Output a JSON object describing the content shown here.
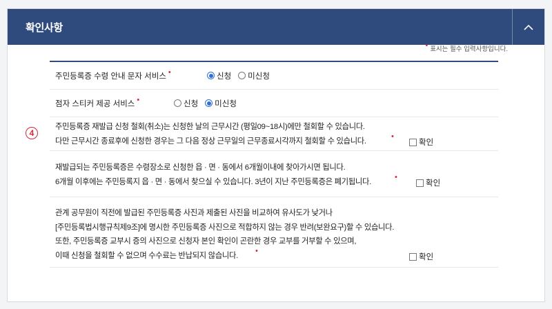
{
  "panel": {
    "title": "확인사항",
    "toggle_icon": "chevron-up-icon"
  },
  "required_note": {
    "marker": "•",
    "text": "표시는 필수 입력사항입니다."
  },
  "step_number": "4",
  "options": [
    {
      "label": "주민등록증 수령 안내 문자 서비스",
      "required_marker": "•",
      "choices": [
        "신청",
        "미신청"
      ],
      "selected": "신청"
    },
    {
      "label": "점자 스티커 제공 서비스",
      "required_marker": "•",
      "choices": [
        "신청",
        "미신청"
      ],
      "selected": "미신청"
    }
  ],
  "notices": [
    {
      "lines": [
        "주민등록증 재발급 신청 철회(취소)는 신청한 날의 근무시간 (평일09~18시)에만 철회할 수 있습니다.",
        "다만 근무시간 종료후에 신청한 경우는 그 다음 정상 근무일의 근무종료시각까지 철회할 수 있습니다."
      ],
      "required_marker": "•",
      "confirm_label": "확인",
      "checked": false
    },
    {
      "lines": [
        "재발급되는 주민등록증은 수령장소로 신청한 읍 · 면 · 동에서 6개월이내에 찾아가시면 됩니다.",
        "6개월 이후에는 주민등록지 읍 · 면 · 동에서 찾으실 수 있습니다. 3년이 지난 주민등록증은 폐기됩니다."
      ],
      "required_marker": "•",
      "confirm_label": "확인",
      "checked": false
    },
    {
      "lines": [
        "관계 공무원이 직전에 발급된 주민등록증 사진과 제출된 사진을 비교하여 유사도가 낮거나",
        "[주민등록법시행규칙제9조]에 명시한 주민등록증 사진으로 적합하지 않는 경우 반려(보완요구)할 수 있습니다.",
        "또한, 주민등록증 교부시 증의 사진으로 신청자 본인 확인이 곤란한 경우 교부를 거부할 수 있으며,",
        "이때 신청을 철회할 수 없으며 수수료는 반납되지 않습니다."
      ],
      "required_marker": "•",
      "confirm_label": "확인",
      "checked": false
    }
  ],
  "colors": {
    "header_bg": "#2f4a7d",
    "required_red": "#d6263a",
    "radio_blue": "#2f6fd4"
  }
}
